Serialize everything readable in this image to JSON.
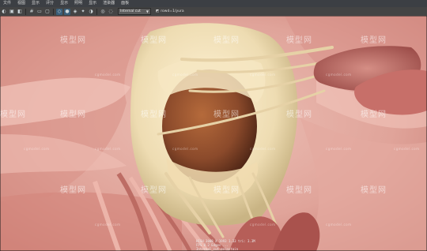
{
  "menu": {
    "items": [
      "文件",
      "视图",
      "显示",
      "评分",
      "显示",
      "照明",
      "显示",
      "渲染器",
      "面板"
    ]
  },
  "toolbar": {
    "dropdown_value": "Internal cut",
    "camera_label": "rowd=1/yura",
    "accent_color": "#3a5f7a"
  },
  "watermark": {
    "main": "模型网",
    "sub": "cgmodel.com"
  },
  "hud": {
    "line1": "HIGH  3008 X  1993  1.33   tri: 3.3M",
    "line2": "FPS   8.2    Edges  ...",
    "line3": "Internal_cut    mainstain"
  },
  "colors": {
    "tissue": "#e0a49a",
    "tissue_dark": "#b8665f",
    "valve": "#f2e2be",
    "chamber": "#8b4a2b"
  }
}
